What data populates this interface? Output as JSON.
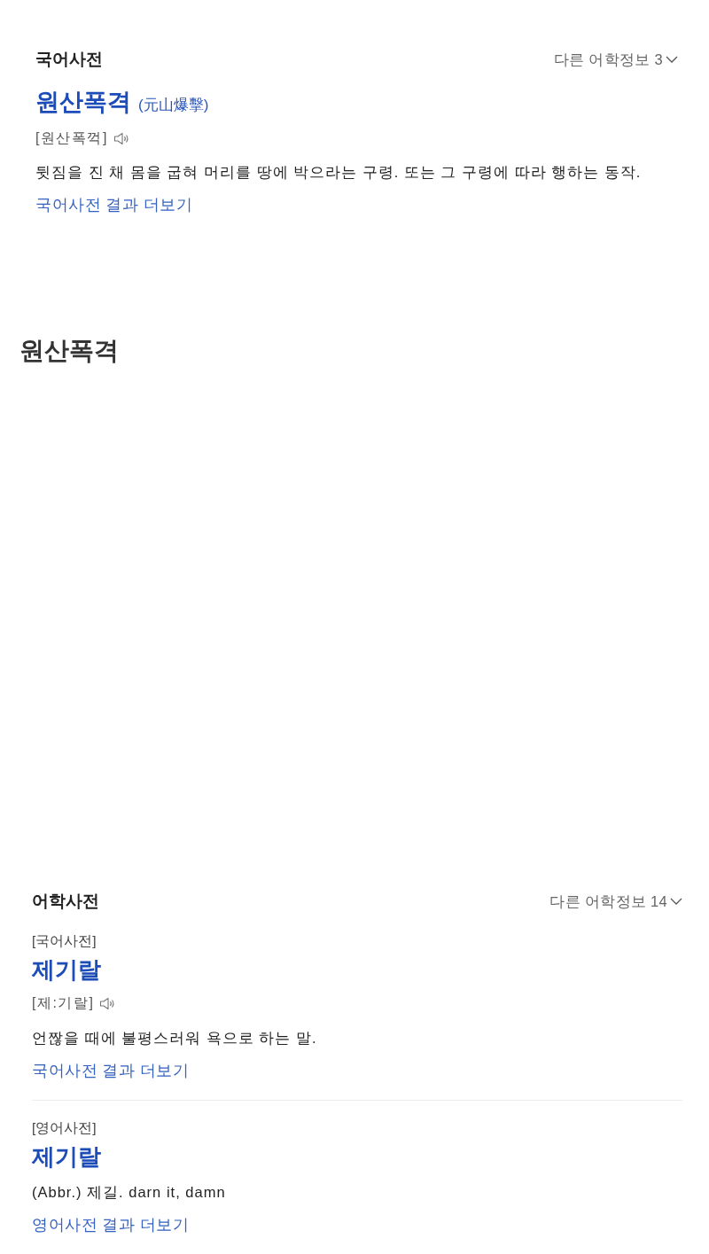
{
  "korean_dictionary_card": {
    "title": "국어사전",
    "more_info": "다른 어학정보 3",
    "entry": {
      "headword": "원산폭격",
      "hanja": "(元山爆擊)",
      "pronunciation": "[원산폭꺽]",
      "definition": "뒷짐을 진 채 몸을 굽혀 머리를 땅에 박으라는 구령. 또는 그 구령에 따라 행하는 동작.",
      "more_link": "국어사전 결과 더보기"
    }
  },
  "heading": "원산폭격",
  "language_dictionary_card": {
    "title": "어학사전",
    "more_info": "다른 어학정보 14",
    "entries": [
      {
        "source": "[국어사전]",
        "headword": "제기랄",
        "pronunciation": "[제:기랄]",
        "definition": "언짢을 때에 불평스러워 욕으로 하는 말.",
        "more_link": "국어사전 결과 더보기"
      },
      {
        "source": "[영어사전]",
        "headword": "제기랄",
        "definition": "(Abbr.) 제길. darn it, damn",
        "more_link": "영어사전 결과 더보기"
      }
    ]
  }
}
